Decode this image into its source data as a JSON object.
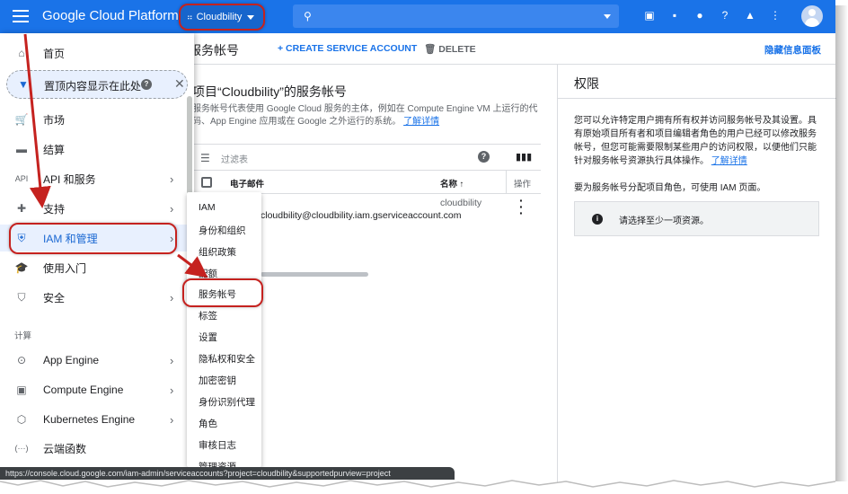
{
  "topbar": {
    "brand": "Google Cloud Platform",
    "project": "Cloudbility",
    "search_placeholder": ""
  },
  "toolbar": {
    "page_title": "服务帐号",
    "create_label": "+ CREATE SERVICE ACCOUNT",
    "delete_label": "DELETE",
    "hide_panel": "隐藏信息面板"
  },
  "content": {
    "title": "项目“Cloudbility”的服务帐号",
    "desc": "服务帐号代表使用 Google Cloud 服务的主体，例如在 Compute Engine VM 上运行的代码、App Engine 应用或在 Google 之外运行的系统。",
    "learn_more": "了解详情"
  },
  "table": {
    "filter_placeholder": "过滤表",
    "col_email": "电子邮件",
    "col_name": "名称 ↑",
    "col_ops": "操作",
    "rows": [
      {
        "email": "cloudbility@cloudbility.iam.gserviceaccount.com",
        "name": "cloudbility"
      }
    ]
  },
  "right_panel": {
    "title": "权限",
    "desc": "您可以允许特定用户拥有所有权并访问服务帐号及其设置。具有原始项目所有者和项目编辑者角色的用户已经可以修改服务帐号，但您可能需要限制某些用户的访问权限，以便他们只能针对服务帐号资源执行具体操作。",
    "learn_more": "了解详情",
    "hint": "要为服务帐号分配项目角色，可使用 IAM 页面。",
    "box_text": "请选择至少一项资源。"
  },
  "nav": {
    "home": "首页",
    "pinned": "置顶内容显示在此处",
    "items": [
      {
        "label": "市场",
        "icon": "cart-icon",
        "glyph": "🛒"
      },
      {
        "label": "结算",
        "icon": "billing-icon",
        "glyph": "▬"
      },
      {
        "label": "API 和服务",
        "icon": "api-icon",
        "glyph": "API"
      },
      {
        "label": "支持",
        "icon": "support-icon",
        "glyph": "✚"
      },
      {
        "label": "IAM 和管理",
        "icon": "shield-icon",
        "glyph": "⛨"
      },
      {
        "label": "使用入门",
        "icon": "school-icon",
        "glyph": "🎓"
      },
      {
        "label": "安全",
        "icon": "security-icon",
        "glyph": "⛉"
      }
    ],
    "section": "计算",
    "compute_items": [
      {
        "label": "App Engine",
        "icon": "app-engine-icon",
        "glyph": "⊙"
      },
      {
        "label": "Compute Engine",
        "icon": "chip-icon",
        "glyph": "▣"
      },
      {
        "label": "Kubernetes Engine",
        "icon": "kubernetes-icon",
        "glyph": "⬡"
      },
      {
        "label": "云端函数",
        "icon": "functions-icon",
        "glyph": "(···)"
      }
    ]
  },
  "submenu": {
    "items": [
      "IAM",
      "身份和组织",
      "组织政策",
      "配额",
      "服务帐号",
      "标签",
      "设置",
      "隐私权和安全",
      "加密密钥",
      "身份识别代理",
      "角色",
      "审核日志",
      "管理资源"
    ]
  },
  "status_url": "https://console.cloud.google.com/iam-admin/serviceaccounts?project=cloudbility&supportedpurview=project"
}
